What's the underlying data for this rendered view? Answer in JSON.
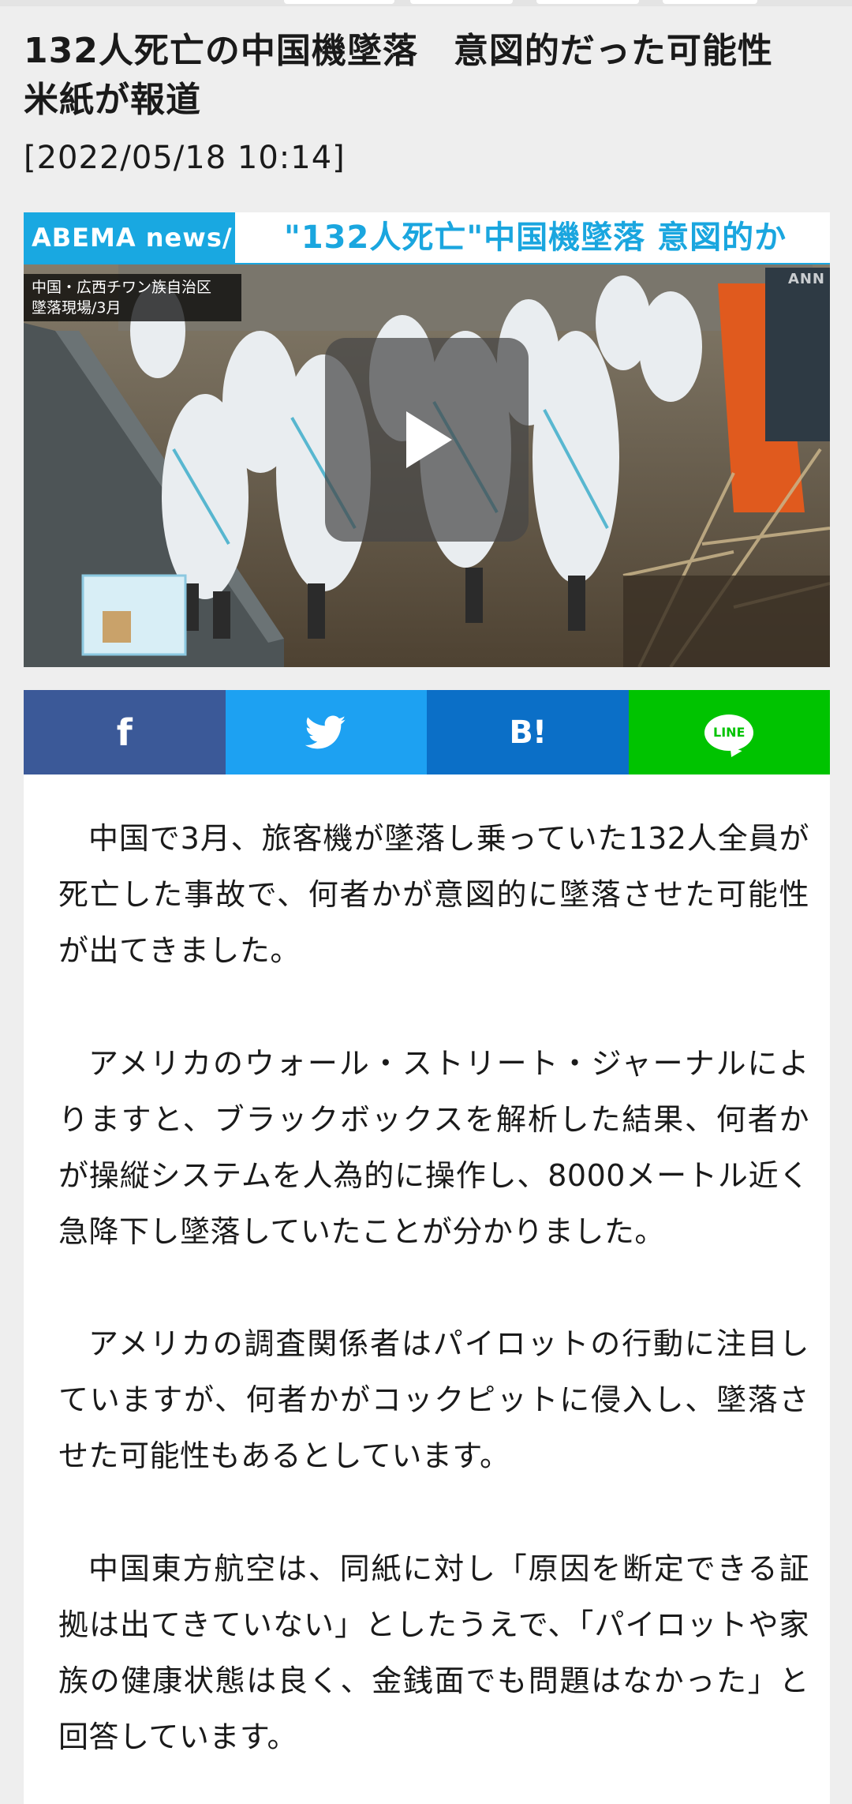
{
  "article": {
    "title": "132人死亡の中国機墜落　意図的だった可能性　米紙が報道",
    "date": "[2022/05/18 10:14]",
    "paragraphs": [
      "中国で3月、旅客機が墜落し乗っていた132人全員が死亡した事故で、何者かが意図的に墜落させた可能性が出てきました。",
      "アメリカのウォール・ストリート・ジャーナルによりますと、ブラックボックスを解析した結果、何者かが操縦システムを人為的に操作し、8000メートル近く急降下し墜落していたことが分かりました。",
      "アメリカの調査関係者はパイロットの行動に注目していますが、何者かがコックピットに侵入し、墜落させた可能性もあるとしています。",
      "中国東方航空は、同紙に対し「原因を断定できる証拠は出てきていない」としたうえで、「パイロットや家族の健康状態は良く、金銭面でも問題はなかった」と回答しています。"
    ]
  },
  "video": {
    "banner_logo": "ABEMA news/",
    "banner_headline": "\"132人死亡\"中国機墜落 意図的か",
    "caption_line1": "中国・広西チワン族自治区",
    "caption_line2": "墜落現場/3月",
    "watermark": "ANN"
  },
  "share": {
    "facebook_icon": "f",
    "hatena_icon": "B!",
    "line_icon": "LINE"
  },
  "colors": {
    "facebook": "#3b5998",
    "twitter": "#1da1f2",
    "hatena": "#0b6fc7",
    "line": "#00c300",
    "abema_blue": "#19a8e1"
  }
}
